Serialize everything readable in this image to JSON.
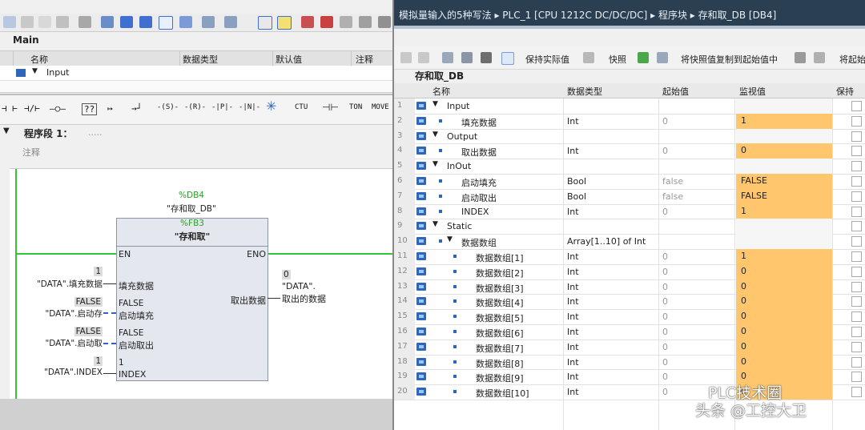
{
  "left_window": {
    "main_label": "Main",
    "interface_headers": {
      "name": "名称",
      "type": "数据类型",
      "default": "默认值",
      "comment": "注释"
    },
    "interface_row": {
      "expand": "▼",
      "name": "Input"
    },
    "ladder_tools": [
      "⊣ ⊢",
      "⊣/⊢",
      "–○–",
      "??",
      "↦",
      "→┘",
      "-(S)-",
      "-(R)-",
      "-|P|-",
      "-|N|-",
      "CTU",
      "TON",
      "MOVE"
    ],
    "segment": {
      "title": "程序段 1：",
      "dots": ".....",
      "comment_placeholder": "注释"
    },
    "block": {
      "db_ref": "%DB4",
      "db_name": "\"存和取_DB\"",
      "fb_ref": "%FB3",
      "fb_name": "\"存和取\"",
      "pin_en": "EN",
      "pin_eno": "ENO",
      "in1_name": "填充数据",
      "in1_value": "1",
      "in1_param": "\"DATA\".填充数据",
      "in2_name": "启动填充",
      "in2_value": "FALSE",
      "in2_param": "\"DATA\".启动存",
      "in2_inner": "FALSE",
      "in3_name": "启动取出",
      "in3_value": "FALSE",
      "in3_param": "\"DATA\".启动取",
      "in3_inner": "FALSE",
      "in4_name": "INDEX",
      "in4_value": "1",
      "in4_param": "\"DATA\".INDEX",
      "in4_inner": "1",
      "out1_name": "取出数据",
      "out1_value": "0",
      "out1_param_a": "\"DATA\".",
      "out1_param_b": "取出的数据"
    }
  },
  "right_window": {
    "breadcrumb": "模拟量输入的5种写法 ▸ PLC_1 [CPU 1212C DC/DC/DC] ▸ 程序块 ▸ 存和取_DB [DB4]",
    "toolbar": {
      "keep_actual": "保持实际值",
      "snapshot": "快照",
      "copy_snapshot": "将快照值复制到起始值中",
      "load_start": "将起始"
    },
    "db_title": "存和取_DB",
    "grid_headers": {
      "name": "名称",
      "type": "数据类型",
      "start": "起始值",
      "monitor": "监视值",
      "retain": "保持"
    },
    "rows": [
      {
        "num": "1",
        "level": 0,
        "expand": "▼",
        "name": "Input",
        "type": "",
        "start": "",
        "monitor": ""
      },
      {
        "num": "2",
        "level": 1,
        "expand": "",
        "name": "填充数据",
        "type": "Int",
        "start": "0",
        "monitor": "1"
      },
      {
        "num": "3",
        "level": 0,
        "expand": "▼",
        "name": "Output",
        "type": "",
        "start": "",
        "monitor": ""
      },
      {
        "num": "4",
        "level": 1,
        "expand": "",
        "name": "取出数据",
        "type": "Int",
        "start": "0",
        "monitor": "0"
      },
      {
        "num": "5",
        "level": 0,
        "expand": "▼",
        "name": "InOut",
        "type": "",
        "start": "",
        "monitor": ""
      },
      {
        "num": "6",
        "level": 1,
        "expand": "",
        "name": "启动填充",
        "type": "Bool",
        "start": "false",
        "monitor": "FALSE"
      },
      {
        "num": "7",
        "level": 1,
        "expand": "",
        "name": "启动取出",
        "type": "Bool",
        "start": "false",
        "monitor": "FALSE"
      },
      {
        "num": "8",
        "level": 1,
        "expand": "",
        "name": "INDEX",
        "type": "Int",
        "start": "0",
        "monitor": "1"
      },
      {
        "num": "9",
        "level": 0,
        "expand": "▼",
        "name": "Static",
        "type": "",
        "start": "",
        "monitor": ""
      },
      {
        "num": "10",
        "level": 1,
        "expand": "▼",
        "name": "数据数组",
        "type": "Array[1..10] of Int",
        "start": "",
        "monitor": ""
      },
      {
        "num": "11",
        "level": 2,
        "expand": "",
        "name": "数据数组[1]",
        "type": "Int",
        "start": "0",
        "monitor": "1"
      },
      {
        "num": "12",
        "level": 2,
        "expand": "",
        "name": "数据数组[2]",
        "type": "Int",
        "start": "0",
        "monitor": "0"
      },
      {
        "num": "13",
        "level": 2,
        "expand": "",
        "name": "数据数组[3]",
        "type": "Int",
        "start": "0",
        "monitor": "0"
      },
      {
        "num": "14",
        "level": 2,
        "expand": "",
        "name": "数据数组[4]",
        "type": "Int",
        "start": "0",
        "monitor": "0"
      },
      {
        "num": "15",
        "level": 2,
        "expand": "",
        "name": "数据数组[5]",
        "type": "Int",
        "start": "0",
        "monitor": "0"
      },
      {
        "num": "16",
        "level": 2,
        "expand": "",
        "name": "数据数组[6]",
        "type": "Int",
        "start": "0",
        "monitor": "0"
      },
      {
        "num": "17",
        "level": 2,
        "expand": "",
        "name": "数据数组[7]",
        "type": "Int",
        "start": "0",
        "monitor": "0"
      },
      {
        "num": "18",
        "level": 2,
        "expand": "",
        "name": "数据数组[8]",
        "type": "Int",
        "start": "0",
        "monitor": "0"
      },
      {
        "num": "19",
        "level": 2,
        "expand": "",
        "name": "数据数组[9]",
        "type": "Int",
        "start": "0",
        "monitor": "0"
      },
      {
        "num": "20",
        "level": 2,
        "expand": "",
        "name": "数据数组[10]",
        "type": "Int",
        "start": "0",
        "monitor": "0"
      }
    ]
  },
  "watermark": {
    "line1": "PLC技术圈",
    "line2": "头条 @工控大卫"
  },
  "colors": {
    "monitor": "#ffc66d",
    "title_bar": "#2b3f52",
    "power_rail": "#35c435",
    "fb_fill": "#e4e8ee"
  }
}
